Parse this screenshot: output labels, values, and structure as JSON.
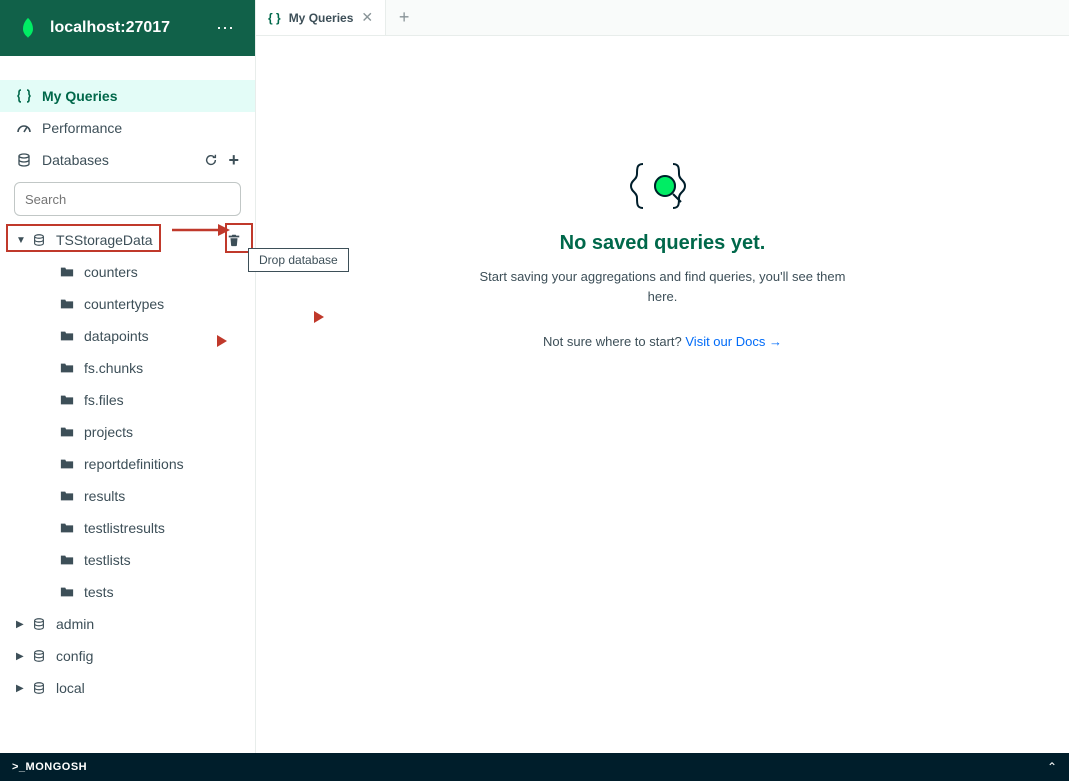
{
  "header": {
    "connection": "localhost:27017"
  },
  "nav": {
    "my_queries": "My Queries",
    "performance": "Performance",
    "databases": "Databases"
  },
  "search": {
    "placeholder": "Search"
  },
  "databases": [
    {
      "name": "TSStorageData",
      "expanded": true,
      "highlighted": true,
      "collections": [
        "counters",
        "countertypes",
        "datapoints",
        "fs.chunks",
        "fs.files",
        "projects",
        "reportdefinitions",
        "results",
        "testlistresults",
        "testlists",
        "tests"
      ]
    },
    {
      "name": "admin",
      "expanded": false
    },
    {
      "name": "config",
      "expanded": false
    },
    {
      "name": "local",
      "expanded": false
    }
  ],
  "tooltip": {
    "drop_database": "Drop database"
  },
  "tab": {
    "label": "My Queries"
  },
  "empty": {
    "title": "No saved queries yet.",
    "subtitle": "Start saving your aggregations and find queries, you'll see them here.",
    "help_prefix": "Not sure where to start?  ",
    "help_link": "Visit our Docs →"
  },
  "mongosh": {
    "label": ">_MONGOSH"
  }
}
